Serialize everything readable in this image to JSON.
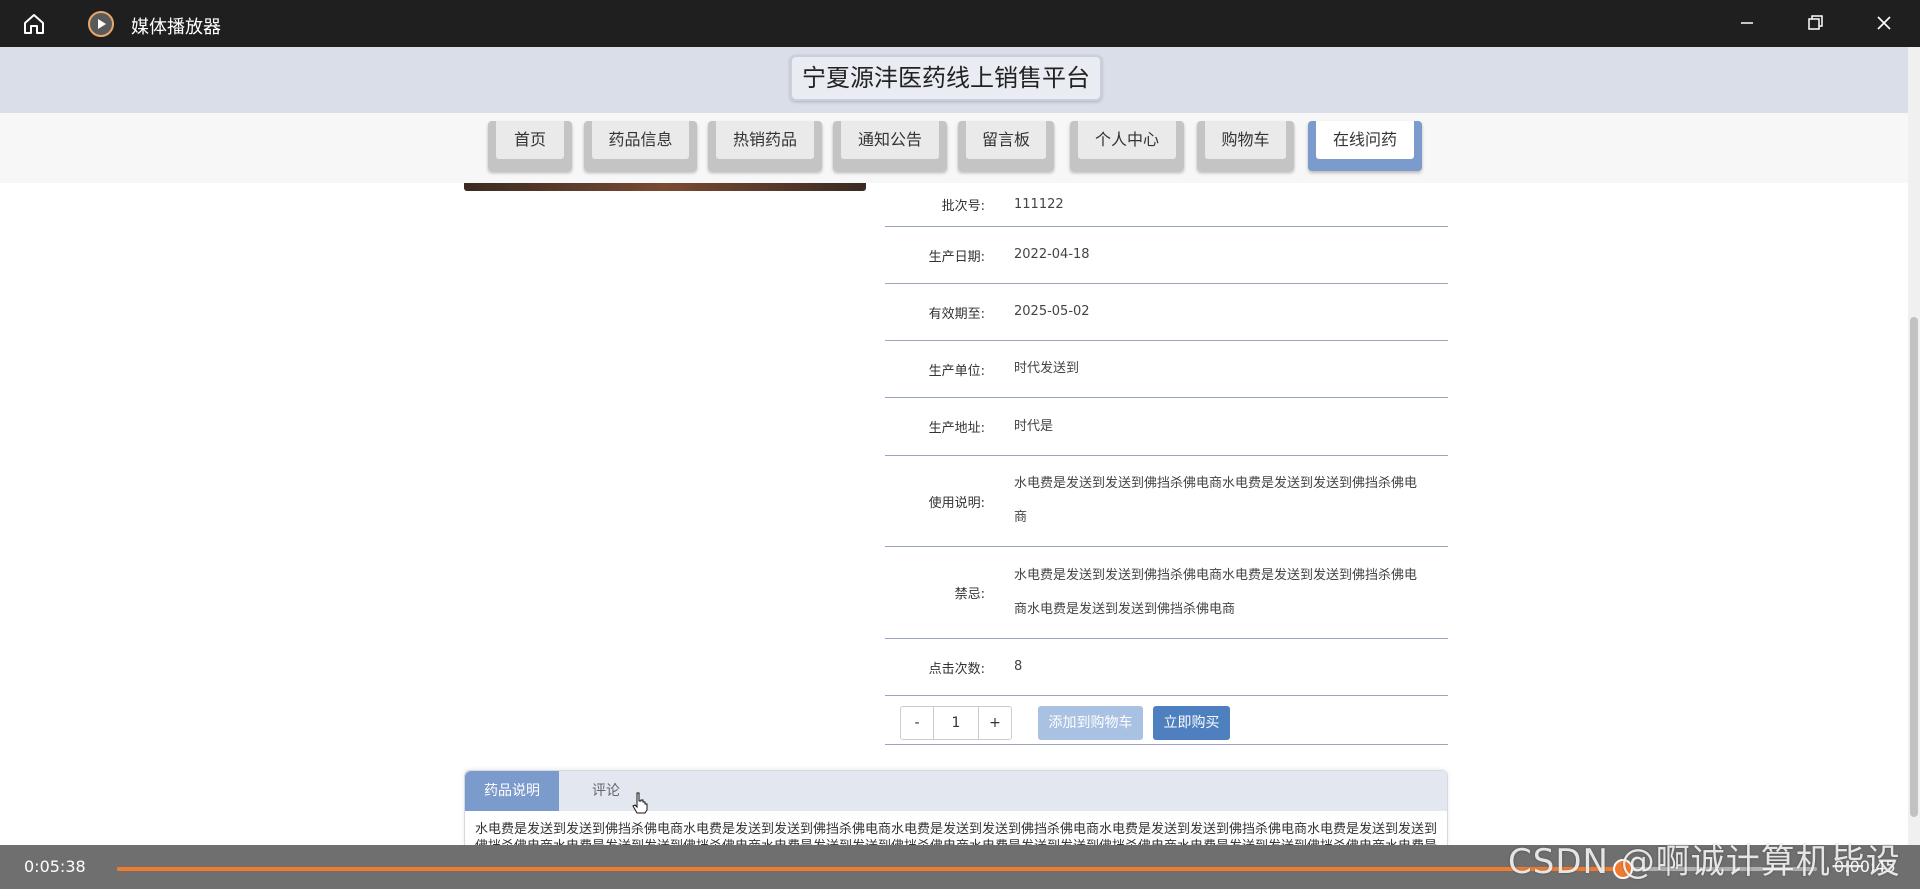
{
  "player": {
    "title": "媒体播放器",
    "time_elapsed": "0:05:38",
    "time_remaining": "0:00:45",
    "progress": 0.886,
    "progress_color": "#f07b2f"
  },
  "site": {
    "title": "宁夏源沣医药线上销售平台",
    "nav": [
      {
        "label": "首页",
        "active": false
      },
      {
        "label": "药品信息",
        "active": false
      },
      {
        "label": "热销药品",
        "active": false
      },
      {
        "label": "通知公告",
        "active": false
      },
      {
        "label": "留言板",
        "active": false
      },
      {
        "label": "个人中心",
        "active": false
      },
      {
        "label": "购物车",
        "active": false
      },
      {
        "label": "在线问药",
        "active": true
      }
    ],
    "accent_color": "#7b9bcc"
  },
  "product": {
    "rows": [
      {
        "label": "批次号:",
        "value": "111122"
      },
      {
        "label": "生产日期:",
        "value": "2022-04-18"
      },
      {
        "label": "有效期至:",
        "value": "2025-05-02"
      },
      {
        "label": "生产单位:",
        "value": "时代发送到"
      },
      {
        "label": "生产地址:",
        "value": "时代是"
      },
      {
        "label": "使用说明:",
        "value": "水电费是发送到发送到佛挡杀佛电商水电费是发送到发送到佛挡杀佛电商"
      },
      {
        "label": "禁忌:",
        "value": "水电费是发送到发送到佛挡杀佛电商水电费是发送到发送到佛挡杀佛电商水电费是发送到发送到佛挡杀佛电商"
      },
      {
        "label": "点击次数:",
        "value": "8"
      }
    ],
    "quantity": {
      "minus": "-",
      "value": "1",
      "plus": "+"
    },
    "add_to_cart": "添加到购物车",
    "buy_now": "立即购买"
  },
  "tabs": {
    "items": [
      {
        "label": "药品说明",
        "active": true
      },
      {
        "label": "评论",
        "active": false
      }
    ],
    "description": "水电费是发送到发送到佛挡杀佛电商水电费是发送到发送到佛挡杀佛电商水电费是发送到发送到佛挡杀佛电商水电费是发送到发送到佛挡杀佛电商水电费是发送到发送到佛挡杀佛电商水电费是发送到发送到佛挡杀佛电商水电费是发送到发送到佛挡杀佛电商水电费是发送到发送到佛挡杀佛电商水电费是发送到发送到佛挡杀佛电商水电费是发送到发送到佛挡杀佛电商"
  },
  "watermark": "CSDN @啊诚计算机毕设"
}
